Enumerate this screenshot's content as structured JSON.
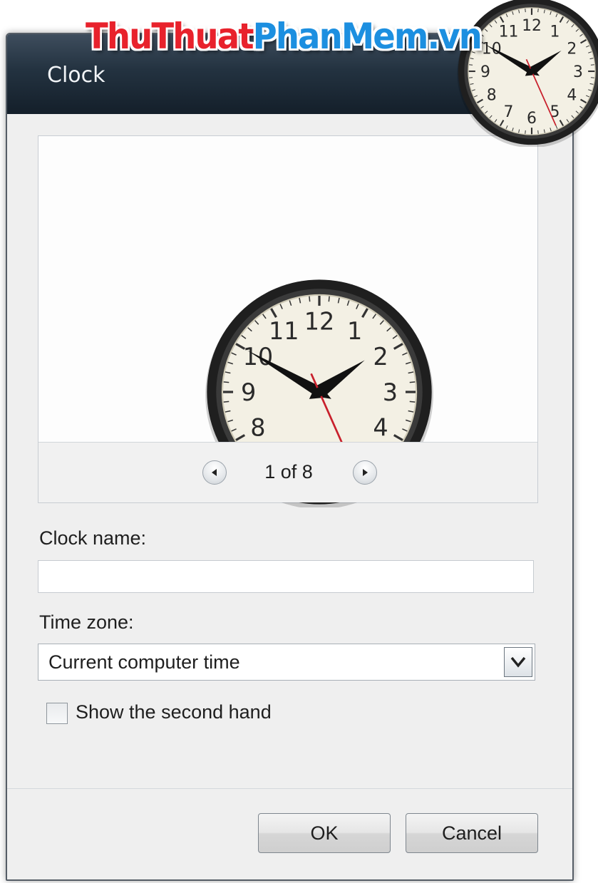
{
  "window": {
    "title": "Clock",
    "watermark": {
      "part1": "ThuThuat",
      "part2": "PhanMem",
      "part3": ".vn"
    }
  },
  "preview": {
    "page_indicator": "1 of 8",
    "clock_numerals": [
      "12",
      "1",
      "2",
      "3",
      "4",
      "5",
      "6",
      "7",
      "8",
      "9",
      "10",
      "11"
    ],
    "time_shown": {
      "hour": 1,
      "minute": 50,
      "second": 26
    }
  },
  "form": {
    "clock_name_label": "Clock name:",
    "clock_name_value": "",
    "time_zone_label": "Time zone:",
    "time_zone_value": "Current computer time",
    "second_hand_label": "Show the second hand",
    "second_hand_checked": false
  },
  "buttons": {
    "ok": "OK",
    "cancel": "Cancel"
  },
  "icons": {
    "prev": "arrow-left-icon",
    "next": "arrow-right-icon",
    "dropdown": "chevron-down-icon",
    "clock": "analog-clock-icon"
  },
  "colors": {
    "titlebar": "#233240",
    "dialog_bg": "#efefef",
    "watermark_red": "#e8222c",
    "watermark_blue": "#1c8fe0",
    "second_hand": "#c8202c",
    "clock_face": "#f3f0e4"
  }
}
